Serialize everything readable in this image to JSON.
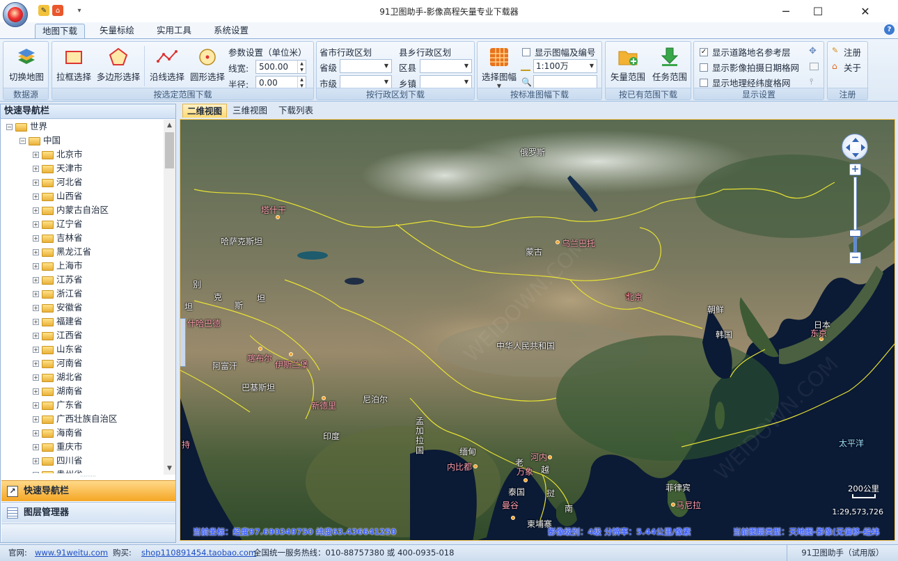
{
  "window": {
    "title": "91卫图助手-影像高程矢量专业下载器",
    "controls": {
      "minimize": "─",
      "maximize": "☐",
      "close": "✕"
    }
  },
  "ribbon_tabs": [
    "地图下载",
    "矢量标绘",
    "实用工具",
    "系统设置"
  ],
  "ribbon": {
    "data_source": {
      "switch_map": "切换地图",
      "title": "数据源"
    },
    "range": {
      "rect": "拉框选择",
      "polygon": "多边形选择",
      "line": "沿线选择",
      "circle": "圆形选择",
      "params_title": "参数设置（单位米）",
      "line_width_label": "线宽:",
      "line_width_value": "500.00",
      "radius_label": "半径:",
      "radius_value": "0.00",
      "title": "按选定范围下载"
    },
    "admin": {
      "province_city_title": "省市行政区划",
      "province_label": "省级",
      "city_label": "市级",
      "county_town_title": "县乡行政区划",
      "county_label": "区县",
      "town_label": "乡镇",
      "title": "按行政区划下载"
    },
    "sheet": {
      "select_sheet": "选择图幅",
      "show_sheet_label": "显示图幅及编号",
      "scale_value": "1:100万",
      "title": "按标准图幅下载"
    },
    "existing": {
      "vector_range": "矢量范围",
      "task_range": "任务范围",
      "title": "按已有范围下载"
    },
    "display": {
      "road_names": "显示道路地名参考层",
      "road_names_checked": true,
      "capture_date": "显示影像拍摄日期格网",
      "capture_date_checked": false,
      "graticule": "显示地理经纬度格网",
      "graticule_checked": false,
      "title": "显示设置"
    },
    "register": {
      "register": "注册",
      "about": "关于",
      "title": "注册"
    }
  },
  "left_pane": {
    "header": "快速导航栏",
    "tree": {
      "root": "世界",
      "country": "中国",
      "provinces": [
        "北京市",
        "天津市",
        "河北省",
        "山西省",
        "内蒙古自治区",
        "辽宁省",
        "吉林省",
        "黑龙江省",
        "上海市",
        "江苏省",
        "浙江省",
        "安徽省",
        "福建省",
        "江西省",
        "山东省",
        "河南省",
        "湖北省",
        "湖南省",
        "广东省",
        "广西壮族自治区",
        "海南省",
        "重庆市",
        "四川省",
        "贵州省"
      ]
    },
    "bottom_tabs": {
      "quick_nav": "快速导航栏",
      "layer_manager": "图层管理器"
    }
  },
  "map_tabs": [
    "二维视图",
    "三维视图",
    "下载列表"
  ],
  "map": {
    "labels": {
      "russia": "俄罗斯",
      "kazakhstan": "哈萨克斯坦",
      "mongolia": "蒙古",
      "ulaanbaatar": "乌兰巴托",
      "beijing": "北京",
      "prc": "中华人民共和国",
      "nk": "朝鲜",
      "sk": "韩国",
      "japan": "日本",
      "tokyo": "东京",
      "pacific": "太平洋",
      "nepal": "尼泊尔",
      "india": "印度",
      "newdelhi": "新德里",
      "pakistan": "巴基斯坦",
      "afghanistan": "阿富汗",
      "kabul": "喀布尔",
      "islamabad": "伊斯兰堡",
      "tashkent": "塔什干",
      "ashgabat": "什哈巴德",
      "bangladesh": "孟\n加\n拉\n国",
      "myanmar": "缅甸",
      "naypyidaw": "内比都",
      "laos": "老",
      "vientiane": "万象",
      "hanoi": "河内",
      "viet": "越",
      "thailand": "泰国",
      "bangkok": "曼谷",
      "cambodia": "柬埔寨",
      "nan": "南",
      "philippines": "菲律宾",
      "manila": "马尼拉",
      "uz_1": "别",
      "uz_2": "克",
      "uz_3": "斯",
      "uz_4": "坦",
      "fuwei": "尔",
      "gu": "得",
      "kg": "坦",
      "left_stub": "持"
    },
    "scale_label": "200公里",
    "ratio": "1:29,573,726",
    "coord_label": "当前坐标：经度97.690349750 纬度63.436641250",
    "level_label": "影像级别：4级 分辨率：5.44公里/像素",
    "layer_label": "当前图层类型：天地图-影像(无偏移-经纬"
  },
  "statusbar": {
    "website_label": "官网:",
    "website": "www.91weitu.com",
    "buy_label": "购买:",
    "shop": "shop110891454.taobao.com",
    "hotline": "全国统一服务热线：010-88757380 或 400-0935-018",
    "product": "91卫图助手（试用版）"
  },
  "colors": {
    "accent": "#f5c24a",
    "ribbon": "#dde9f6",
    "border_line": "#e8e233",
    "status_text": "#3c5fff"
  }
}
